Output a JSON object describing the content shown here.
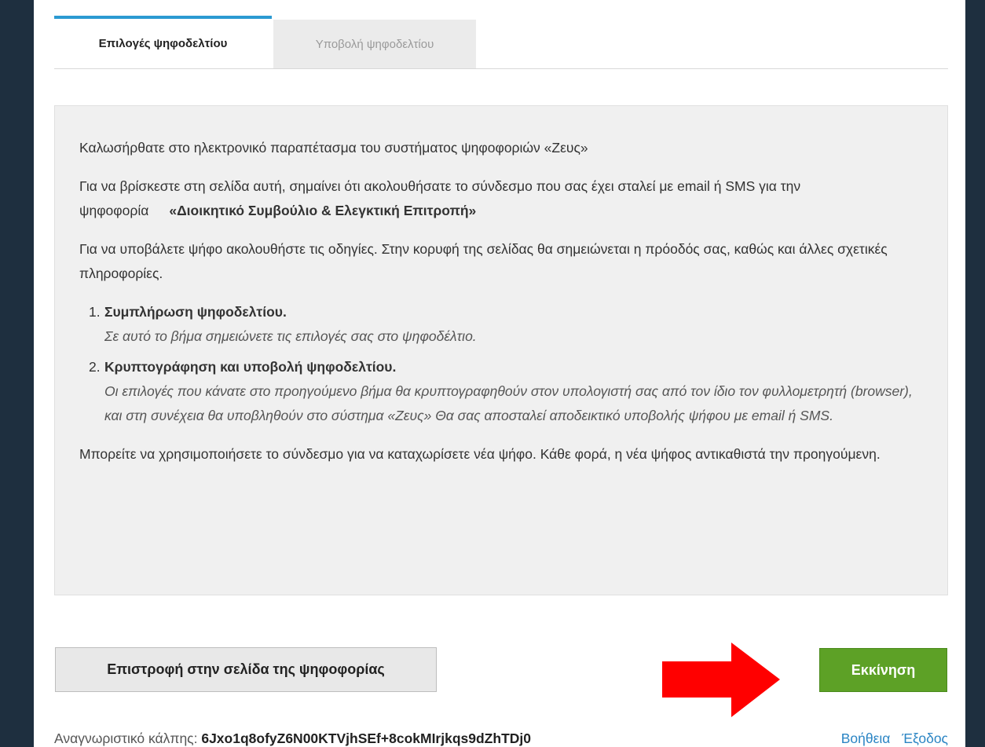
{
  "tabs": {
    "active": "Επιλογές ψηφοδελτίου",
    "inactive": "Υποβολή ψηφοδελτίου"
  },
  "info": {
    "welcome": "Καλωσήρθατε στο ηλεκτρονικό παραπέτασμα του συστήματος ψηφοφοριών «Ζευς»",
    "link_text": "Για να βρίσκεστε στη σελίδα αυτή, σημαίνει ότι ακολουθήσατε το σύνδεσμο που σας έχει σταλεί με email ή SMS για την ψηφοφορία",
    "election_name": "«Διοικητικό Συμβούλιο & Ελεγκτική Επιτροπή»",
    "instructions": "Για να υποβάλετε ψήφο ακολουθήστε τις οδηγίες. Στην κορυφή της σελίδας θα σημειώνεται η πρόοδός σας, καθώς και άλλες σχετικές πληροφορίες.",
    "steps": [
      {
        "num": "1.",
        "title": "Συμπλήρωση ψηφοδελτίου.",
        "desc": "Σε αυτό το βήμα σημειώνετε τις επιλογές σας στο ψηφοδέλτιο."
      },
      {
        "num": "2.",
        "title": "Κρυπτογράφηση και υποβολή ψηφοδελτίου.",
        "desc": "Οι επιλογές που κάνατε στο προηγούμενο βήμα θα κρυπτογραφηθούν στον υπολογιστή σας από τον ίδιο τον φυλλομετρητή (browser), και στη συνέχεια θα υποβληθούν στο σύστημα «Ζευς» Θα σας αποσταλεί αποδεικτικό υποβολής ψήφου με email ή SMS."
      }
    ],
    "revote": "Μπορείτε να χρησιμοποιήσετε το σύνδεσμο για να καταχωρίσετε νέα ψήφο. Κάθε φορά, η νέα ψήφος αντικαθιστά την προηγούμενη."
  },
  "buttons": {
    "back": "Επιστροφή στην σελίδα της ψηφοφορίας",
    "start": "Εκκίνηση"
  },
  "footer": {
    "voter_label": "Αναγνωριστικό κάλπης:",
    "voter_code": "6Jxo1q8ofyZ6N00KTVjhSEf+8cokMIrjkqs9dZhTDj0",
    "help": "Βοήθεια",
    "logout": "Έξοδος"
  },
  "colors": {
    "accent": "#2b9ad2",
    "start_button": "#5da126",
    "arrow": "#ff0000",
    "background": "#1e2f3f"
  }
}
